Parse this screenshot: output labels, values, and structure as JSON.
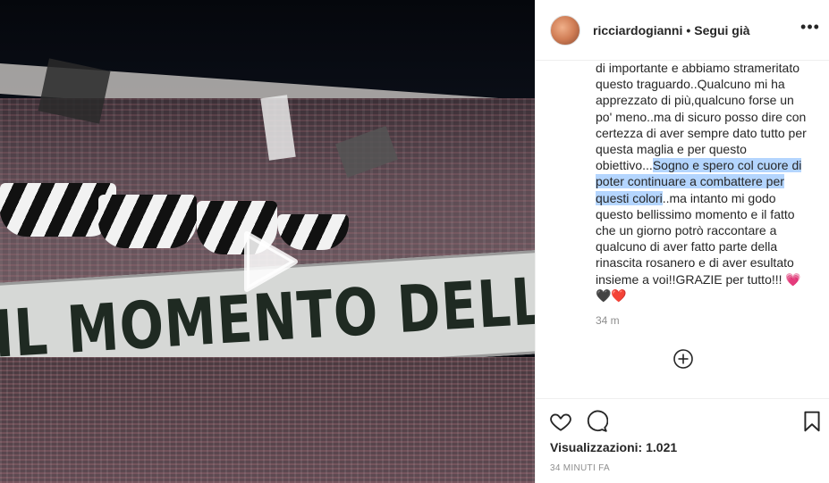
{
  "video": {
    "banner_text": "IL MOMENTO DELLA VERITA DINOS"
  },
  "header": {
    "username": "ricciardogianni",
    "separator": "•",
    "follow_label": "Segui già",
    "more_label": "•••"
  },
  "caption": {
    "part1": "di importante e abbiamo strameritato questo traguardo..Qualcuno mi ha apprezzato di più,qualcuno forse un po' meno..ma di sicuro posso dire con certezza di aver sempre dato tutto per questa maglia e per questo obiettivo...",
    "highlight": "Sogno e spero col cuore di poter continuare a combattere per questi colori",
    "part2": "..ma intanto mi godo questo bellissimo momento e il fatto che un giorno potrò raccontare a qualcuno di aver fatto parte della rinascita rosanero e di aver esultato insieme a voi!!GRAZIE per tutto!!! 💗🖤❤️",
    "time": "34 m"
  },
  "stats": {
    "views_label": "Visualizzazioni:",
    "views_value": "1.021",
    "ago": "34 MINUTI FA"
  },
  "icons": {
    "play": "play-icon",
    "like": "heart-icon",
    "comment": "comment-icon",
    "save": "bookmark-icon",
    "load_more": "plus-circle-icon"
  }
}
